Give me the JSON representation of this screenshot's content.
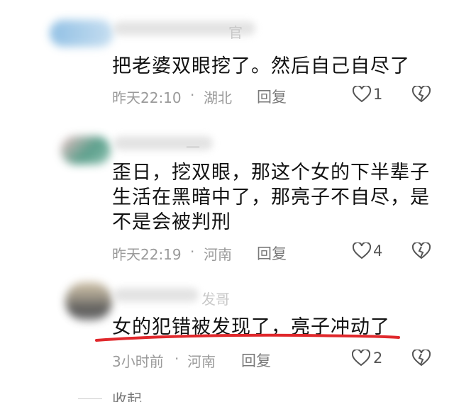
{
  "comments": [
    {
      "username_partial": "官",
      "text": "把老婆双眼挖了。然后自己自尽了",
      "time": "昨天22:10",
      "separator": "·",
      "location": "湖北",
      "reply_label": "回复",
      "likes": "1"
    },
    {
      "username_partial": "一",
      "text": "歪日，挖双眼，那这个女的下半辈子生活在黑暗中了，那亮子不自尽，是不是会被判刑",
      "time": "昨天22:19",
      "separator": "·",
      "location": "河南",
      "reply_label": "回复",
      "likes": "4"
    },
    {
      "username_partial": "发哥",
      "text": "女的犯错被发现了，亮子冲动了",
      "time": "3小时前",
      "separator": "·",
      "location": "河南",
      "reply_label": "回复",
      "likes": "2"
    }
  ],
  "collapse_label": "收起",
  "colors": {
    "underline": "#e0282c",
    "text": "#111111",
    "meta": "#9a9a9a"
  }
}
